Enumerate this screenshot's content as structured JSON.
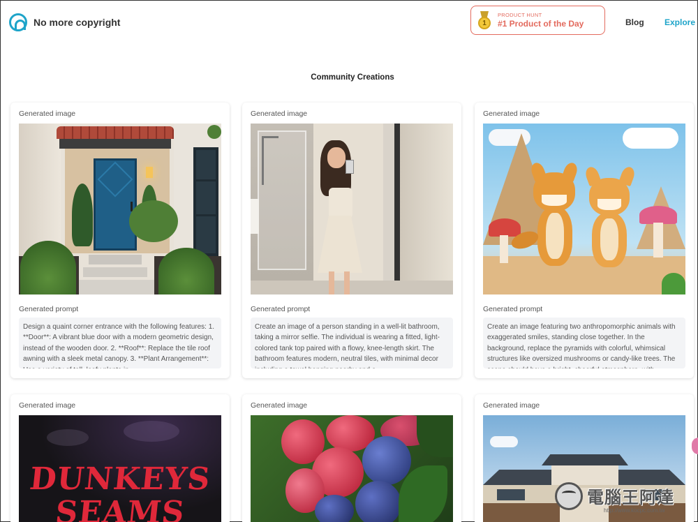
{
  "header": {
    "logo_text": "No more copyright",
    "badge_small": "PRODUCT HUNT",
    "badge_big": "#1 Product of the Day",
    "badge_medal": "1",
    "nav_blog": "Blog",
    "nav_explore": "Explore"
  },
  "section_title": "Community Creations",
  "labels": {
    "image": "Generated image",
    "prompt": "Generated prompt"
  },
  "cards": [
    {
      "prompt": "Design a quaint corner entrance with the following features: 1. **Door**: A vibrant blue door with a modern geometric design, instead of the wooden door. 2. **Roof**: Replace the tile roof awning with a sleek metal canopy. 3. **Plant Arrangement**: Use a variety of tall, leafy plants in",
      "image_icon": "doorway-image"
    },
    {
      "prompt": "Create an image of a person standing in a well-lit bathroom, taking a mirror selfie. The individual is wearing a fitted, light-colored tank top paired with a flowy, knee-length skirt. The bathroom features modern, neutral tiles, with minimal decor including a towel hanging nearby and a",
      "image_icon": "mirror-selfie-image"
    },
    {
      "prompt": "Create an image featuring two anthropomorphic animals with exaggerated smiles, standing close together. In the background, replace the pyramids with colorful, whimsical structures like oversized mushrooms or candy-like trees. The scene should have a bright, cheerful atmosphere, with",
      "image_icon": "cartoon-animals-image"
    },
    {
      "image_icon": "dark-text-art-image",
      "image_text_1": "DUNKEYS",
      "image_text_2": "SEAMS"
    },
    {
      "image_icon": "berries-image"
    },
    {
      "image_icon": "house-image"
    }
  ],
  "watermark_text": "電腦王阿達",
  "watermark_url": "http://www.kocpc.com.tw",
  "colors": {
    "accent": "#1ea4c9",
    "badge": "#e36a5d"
  }
}
